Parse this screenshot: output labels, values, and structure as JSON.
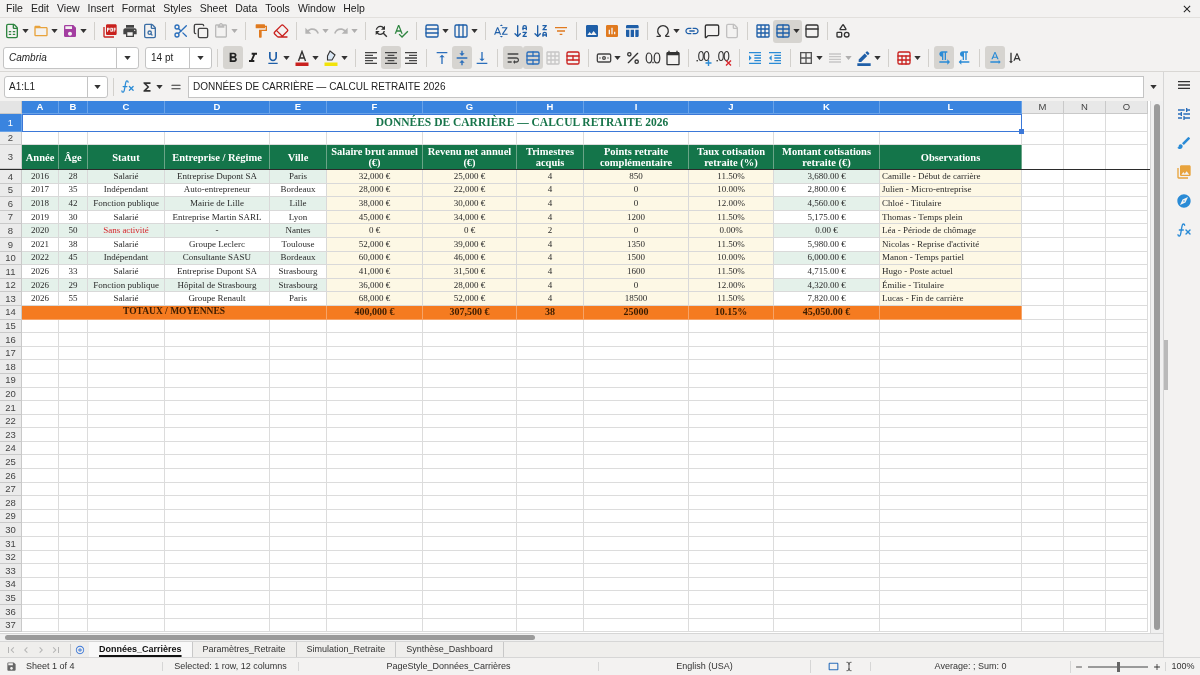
{
  "menu_bar": [
    "File",
    "Edit",
    "View",
    "Insert",
    "Format",
    "Styles",
    "Sheet",
    "Data",
    "Tools",
    "Window",
    "Help"
  ],
  "standard_toolbar": {
    "groups": [
      [
        {
          "kind": "new",
          "dropdown": true,
          "pressed": false,
          "disabled": false
        },
        {
          "kind": "open",
          "dropdown": true,
          "pressed": false,
          "disabled": false
        },
        {
          "kind": "save",
          "dropdown": true,
          "pressed": false,
          "disabled": false
        }
      ],
      [
        {
          "kind": "pdf",
          "dropdown": false,
          "pressed": false,
          "disabled": false
        },
        {
          "kind": "print",
          "dropdown": false,
          "pressed": false,
          "disabled": false
        },
        {
          "kind": "preview",
          "dropdown": false,
          "pressed": false,
          "disabled": false
        }
      ],
      [
        {
          "kind": "cut",
          "dropdown": false,
          "pressed": false,
          "disabled": false
        },
        {
          "kind": "copy",
          "dropdown": false,
          "pressed": false,
          "disabled": false
        },
        {
          "kind": "paste",
          "dropdown": true,
          "pressed": false,
          "disabled": true
        }
      ],
      [
        {
          "kind": "clone",
          "dropdown": false,
          "pressed": false,
          "disabled": false
        },
        {
          "kind": "clear",
          "dropdown": false,
          "pressed": false,
          "disabled": false
        }
      ],
      [
        {
          "kind": "undo",
          "dropdown": true,
          "pressed": false,
          "disabled": true
        },
        {
          "kind": "redo",
          "dropdown": true,
          "pressed": false,
          "disabled": true
        }
      ],
      [
        {
          "kind": "find",
          "dropdown": false,
          "pressed": false,
          "disabled": false
        },
        {
          "kind": "spelling",
          "dropdown": false,
          "pressed": false,
          "disabled": false
        }
      ],
      [
        {
          "kind": "row",
          "dropdown": true,
          "pressed": false,
          "disabled": false
        },
        {
          "kind": "column",
          "dropdown": true,
          "pressed": false,
          "disabled": false
        }
      ],
      [
        {
          "kind": "sort",
          "dropdown": false,
          "pressed": false,
          "disabled": false
        },
        {
          "kind": "sort_ascending",
          "dropdown": false,
          "pressed": false,
          "disabled": false
        },
        {
          "kind": "sort_descending",
          "dropdown": false,
          "pressed": false,
          "disabled": false
        },
        {
          "kind": "autofilter",
          "dropdown": false,
          "pressed": false,
          "disabled": false
        }
      ],
      [
        {
          "kind": "image",
          "dropdown": false,
          "pressed": false,
          "disabled": false
        },
        {
          "kind": "chart",
          "dropdown": false,
          "pressed": false,
          "disabled": false
        },
        {
          "kind": "pivot",
          "dropdown": false,
          "pressed": false,
          "disabled": false
        }
      ],
      [
        {
          "kind": "special_character",
          "dropdown": true,
          "pressed": false,
          "disabled": false
        },
        {
          "kind": "hyperlink",
          "dropdown": false,
          "pressed": false,
          "disabled": false
        },
        {
          "kind": "comment",
          "dropdown": false,
          "pressed": false,
          "disabled": false
        },
        {
          "kind": "header_footer",
          "dropdown": false,
          "pressed": false,
          "disabled": true
        }
      ],
      [
        {
          "kind": "print_area",
          "dropdown": false,
          "pressed": false,
          "disabled": false
        },
        {
          "kind": "freeze",
          "dropdown": true,
          "pressed": true,
          "disabled": false
        },
        {
          "kind": "split",
          "dropdown": false,
          "pressed": false,
          "disabled": false
        }
      ],
      [
        {
          "kind": "draw",
          "dropdown": false,
          "pressed": false,
          "disabled": false
        }
      ]
    ]
  },
  "formatting_toolbar": {
    "font_name": "Cambria",
    "font_size": "14 pt",
    "groups": [
      [
        {
          "kind": "bold",
          "dropdown": false,
          "pressed": true,
          "disabled": false
        },
        {
          "kind": "italic",
          "dropdown": false,
          "pressed": false,
          "disabled": false
        },
        {
          "kind": "underline",
          "dropdown": true,
          "pressed": false,
          "disabled": false
        },
        {
          "kind": "font_color",
          "dropdown": true,
          "pressed": false,
          "disabled": false
        },
        {
          "kind": "highlight",
          "dropdown": true,
          "pressed": false,
          "disabled": false
        }
      ],
      [
        {
          "kind": "align_left",
          "dropdown": false,
          "pressed": false,
          "disabled": false
        },
        {
          "kind": "align_center",
          "dropdown": false,
          "pressed": true,
          "disabled": false
        },
        {
          "kind": "align_right",
          "dropdown": false,
          "pressed": false,
          "disabled": false
        }
      ],
      [
        {
          "kind": "align_top",
          "dropdown": false,
          "pressed": false,
          "disabled": false
        },
        {
          "kind": "align_middle",
          "dropdown": false,
          "pressed": true,
          "disabled": false
        },
        {
          "kind": "align_bottom",
          "dropdown": false,
          "pressed": false,
          "disabled": false
        }
      ],
      [
        {
          "kind": "wrap",
          "dropdown": false,
          "pressed": true,
          "disabled": false
        },
        {
          "kind": "merge_center",
          "dropdown": false,
          "pressed": true,
          "disabled": false
        },
        {
          "kind": "merge",
          "dropdown": false,
          "pressed": false,
          "disabled": true
        },
        {
          "kind": "unmerge",
          "dropdown": false,
          "pressed": false,
          "disabled": false
        }
      ],
      [
        {
          "kind": "currency",
          "dropdown": true,
          "pressed": false,
          "disabled": false
        },
        {
          "kind": "percent",
          "dropdown": false,
          "pressed": false,
          "disabled": false
        },
        {
          "kind": "number",
          "dropdown": false,
          "pressed": false,
          "disabled": false
        },
        {
          "kind": "date",
          "dropdown": false,
          "pressed": false,
          "disabled": false
        }
      ],
      [
        {
          "kind": "add_decimal",
          "dropdown": false,
          "pressed": false,
          "disabled": false
        },
        {
          "kind": "delete_decimal",
          "dropdown": false,
          "pressed": false,
          "disabled": false
        }
      ],
      [
        {
          "kind": "indent",
          "dropdown": false,
          "pressed": false,
          "disabled": false
        },
        {
          "kind": "outdent",
          "dropdown": false,
          "pressed": false,
          "disabled": false
        }
      ],
      [
        {
          "kind": "borders",
          "dropdown": true,
          "pressed": false,
          "disabled": false
        },
        {
          "kind": "border_style",
          "dropdown": true,
          "pressed": false,
          "disabled": true
        },
        {
          "kind": "border_color",
          "dropdown": true,
          "pressed": false,
          "disabled": false
        }
      ],
      [
        {
          "kind": "conditional",
          "dropdown": true,
          "pressed": false,
          "disabled": false
        }
      ],
      [
        {
          "kind": "left_to_right",
          "dropdown": false,
          "pressed": true,
          "disabled": false
        },
        {
          "kind": "right_to_left",
          "dropdown": false,
          "pressed": false,
          "disabled": false
        }
      ],
      [
        {
          "kind": "text_direction",
          "dropdown": false,
          "pressed": true,
          "disabled": false
        },
        {
          "kind": "vertical_text",
          "dropdown": false,
          "pressed": false,
          "disabled": false
        }
      ]
    ]
  },
  "formula_bar": {
    "name_box": "A1:L1",
    "content": "DONNÉES DE CARRIÈRE — CALCUL RETRAITE 2026"
  },
  "sheet": {
    "column_headers": [
      {
        "label": "A",
        "selected": true
      },
      {
        "label": "B",
        "selected": true
      },
      {
        "label": "C",
        "selected": true
      },
      {
        "label": "D",
        "selected": true
      },
      {
        "label": "E",
        "selected": true
      },
      {
        "label": "F",
        "selected": true
      },
      {
        "label": "G",
        "selected": true
      },
      {
        "label": "H",
        "selected": true
      },
      {
        "label": "I",
        "selected": true
      },
      {
        "label": "J",
        "selected": true
      },
      {
        "label": "K",
        "selected": true
      },
      {
        "label": "L",
        "selected": true
      },
      {
        "label": "M",
        "selected": false
      },
      {
        "label": "N",
        "selected": false
      },
      {
        "label": "O",
        "selected": false
      }
    ],
    "row_headers": [
      {
        "label": "1",
        "selected": true
      },
      {
        "label": "2",
        "selected": false
      },
      {
        "label": "3",
        "selected": false
      },
      {
        "label": "4",
        "selected": false
      },
      {
        "label": "5",
        "selected": false
      },
      {
        "label": "6",
        "selected": false
      },
      {
        "label": "7",
        "selected": false
      },
      {
        "label": "8",
        "selected": false
      },
      {
        "label": "9",
        "selected": false
      },
      {
        "label": "10",
        "selected": false
      },
      {
        "label": "11",
        "selected": false
      },
      {
        "label": "12",
        "selected": false
      },
      {
        "label": "13",
        "selected": false
      },
      {
        "label": "14",
        "selected": false
      },
      {
        "label": "15",
        "selected": false
      },
      {
        "label": "16",
        "selected": false
      },
      {
        "label": "17",
        "selected": false
      },
      {
        "label": "18",
        "selected": false
      },
      {
        "label": "19",
        "selected": false
      },
      {
        "label": "20",
        "selected": false
      },
      {
        "label": "21",
        "selected": false
      },
      {
        "label": "22",
        "selected": false
      },
      {
        "label": "23",
        "selected": false
      },
      {
        "label": "24",
        "selected": false
      },
      {
        "label": "25",
        "selected": false
      },
      {
        "label": "26",
        "selected": false
      },
      {
        "label": "27",
        "selected": false
      },
      {
        "label": "28",
        "selected": false
      },
      {
        "label": "29",
        "selected": false
      },
      {
        "label": "30",
        "selected": false
      },
      {
        "label": "31",
        "selected": false
      },
      {
        "label": "32",
        "selected": false
      },
      {
        "label": "33",
        "selected": false
      },
      {
        "label": "34",
        "selected": false
      },
      {
        "label": "35",
        "selected": false
      },
      {
        "label": "36",
        "selected": false
      },
      {
        "label": "37",
        "selected": false
      }
    ],
    "title": {
      "text": "DONNÉES DE CARRIÈRE — CALCUL RETRAITE 2026",
      "selected": true
    },
    "header_row": [
      "Année",
      "Âge",
      "Statut",
      "Entreprise / Régime",
      "Ville",
      "Salaire brut annuel (€)",
      "Revenu net annuel (€)",
      "Trimestres acquis",
      "Points retraite complémentaire",
      "Taux cotisation retraite (%)",
      "Montant cotisations retraite (€)",
      "Observations"
    ],
    "rows": [
      {
        "cells": [
          "2016",
          "28",
          "Salarié",
          "Entreprise Dupont SA",
          "Paris",
          "32,000 €",
          "25,000 €",
          "4",
          "850",
          "11.50%",
          "3,680.00 €",
          "Camille - Début de carrière"
        ],
        "status_alert": false
      },
      {
        "cells": [
          "2017",
          "35",
          "Indépendant",
          "Auto-entrepreneur",
          "Bordeaux",
          "28,000 €",
          "22,000 €",
          "4",
          "0",
          "10.00%",
          "2,800.00 €",
          "Julien - Micro-entreprise"
        ],
        "status_alert": false
      },
      {
        "cells": [
          "2018",
          "42",
          "Fonction publique",
          "Mairie de Lille",
          "Lille",
          "38,000 €",
          "30,000 €",
          "4",
          "0",
          "12.00%",
          "4,560.00 €",
          "Chloé - Titulaire"
        ],
        "status_alert": false
      },
      {
        "cells": [
          "2019",
          "30",
          "Salarié",
          "Entreprise Martin SARL",
          "Lyon",
          "45,000 €",
          "34,000 €",
          "4",
          "1200",
          "11.50%",
          "5,175.00 €",
          "Thomas - Temps plein"
        ],
        "status_alert": false
      },
      {
        "cells": [
          "2020",
          "50",
          "Sans activité",
          "-",
          "Nantes",
          "0 €",
          "0 €",
          "2",
          "0",
          "0.00%",
          "0.00 €",
          "Léa - Période de chômage"
        ],
        "status_alert": true
      },
      {
        "cells": [
          "2021",
          "38",
          "Salarié",
          "Groupe Leclerc",
          "Toulouse",
          "52,000 €",
          "39,000 €",
          "4",
          "1350",
          "11.50%",
          "5,980.00 €",
          "Nicolas - Reprise d'activité"
        ],
        "status_alert": false
      },
      {
        "cells": [
          "2022",
          "45",
          "Indépendant",
          "Consultante SASU",
          "Bordeaux",
          "60,000 €",
          "46,000 €",
          "4",
          "1500",
          "10.00%",
          "6,000.00 €",
          "Manon - Temps partiel"
        ],
        "status_alert": false
      },
      {
        "cells": [
          "2026",
          "33",
          "Salarié",
          "Entreprise Dupont SA",
          "Strasbourg",
          "41,000 €",
          "31,500 €",
          "4",
          "1600",
          "11.50%",
          "4,715.00 €",
          "Hugo - Poste actuel"
        ],
        "status_alert": false
      },
      {
        "cells": [
          "2026",
          "29",
          "Fonction publique",
          "Hôpital de Strasbourg",
          "Strasbourg",
          "36,000 €",
          "28,000 €",
          "4",
          "0",
          "12.00%",
          "4,320.00 €",
          "Émilie - Titulaire"
        ],
        "status_alert": false
      },
      {
        "cells": [
          "2026",
          "55",
          "Salarié",
          "Groupe Renault",
          "Paris",
          "68,000 €",
          "52,000 €",
          "4",
          "18500",
          "11.50%",
          "7,820.00 €",
          "Lucas - Fin de carrière"
        ],
        "status_alert": false
      }
    ],
    "totals": {
      "label": "TOTAUX / MOYENNES",
      "values": [
        "400,000 €",
        "307,500 €",
        "38",
        "25000",
        "10.15%",
        "45,050.00 €"
      ]
    }
  },
  "sheet_tabs": {
    "navigation": [
      {
        "kind": "first",
        "disabled": true
      },
      {
        "kind": "previous",
        "disabled": true
      },
      {
        "kind": "next",
        "disabled": true
      },
      {
        "kind": "last",
        "disabled": true
      }
    ],
    "tabs": [
      {
        "label": "Données_Carrières",
        "selected": true
      },
      {
        "label": "Paramètres_Retraite",
        "selected": false
      },
      {
        "label": "Simulation_Retraite",
        "selected": false
      },
      {
        "label": "Synthèse_Dashboard",
        "selected": false
      }
    ]
  },
  "status_bar": {
    "sheet": "Sheet 1 of 4",
    "selection": "Selected: 1 row, 12 columns",
    "page_style": "PageStyle_Données_Carrières",
    "language": "English (USA)",
    "summary": "Average: ; Sum: 0",
    "zoom": {
      "level": 0.5,
      "label": "100%"
    }
  }
}
